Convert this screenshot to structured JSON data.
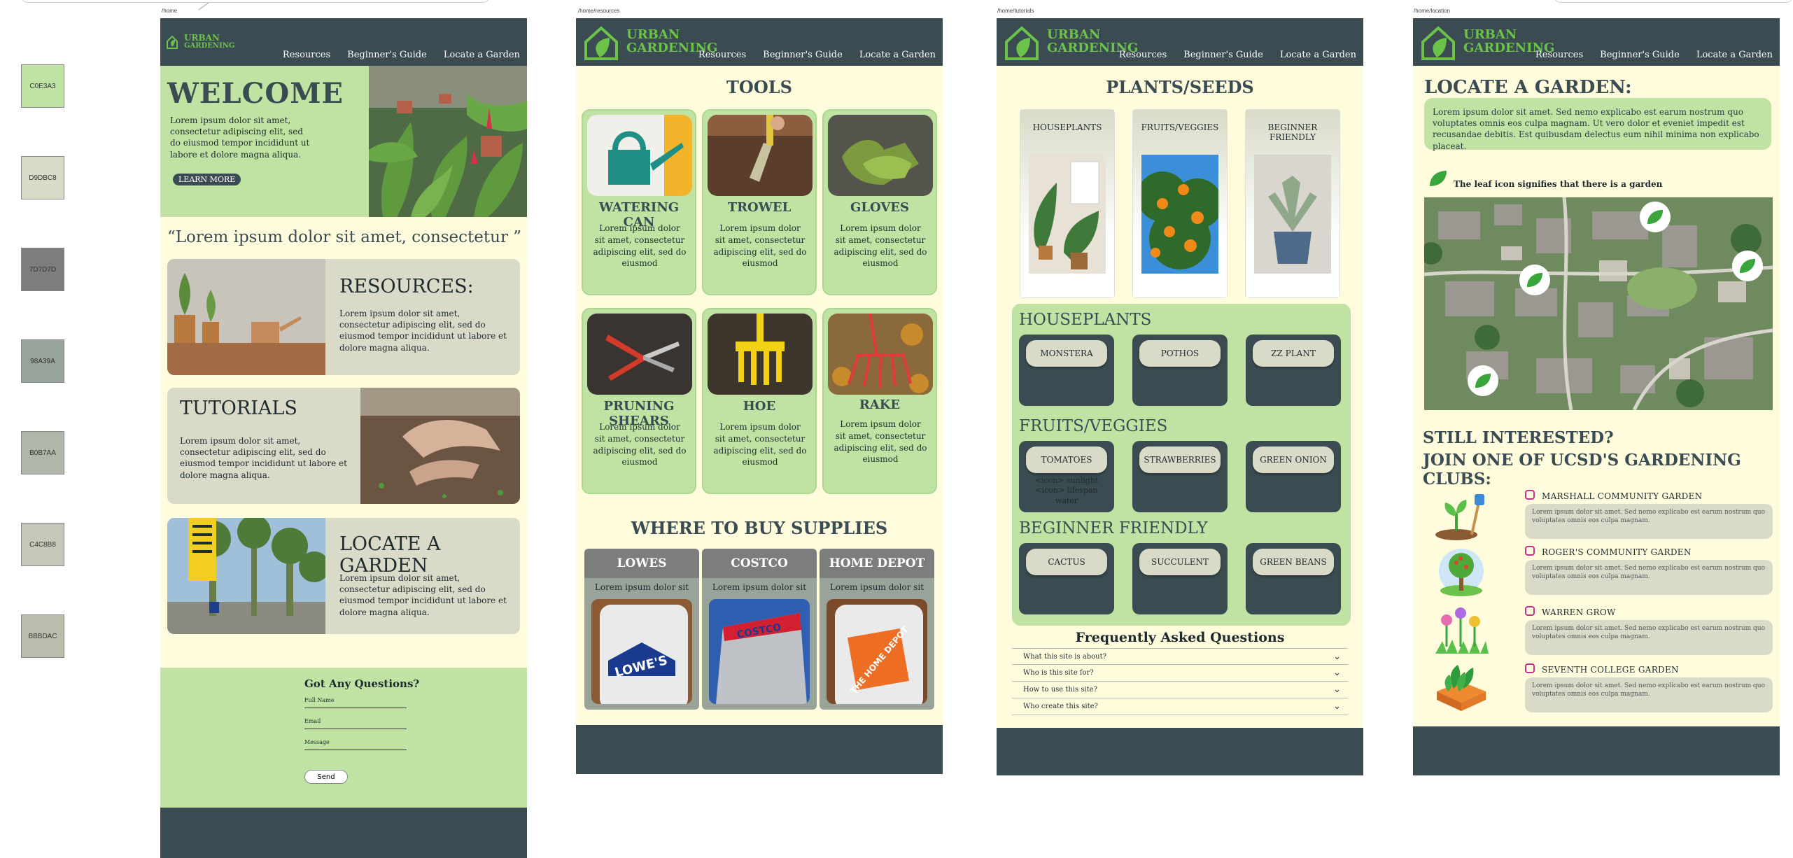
{
  "swatches": [
    "C0E3A3",
    "D9DBC8",
    "7D7D7D",
    "98A39A",
    "B0B7AA",
    "C4C8B8",
    "BBBDAC"
  ],
  "nav": {
    "logo_line1": "URBAN",
    "logo_line2": "GARDENING",
    "links": [
      "Resources",
      "Beginner's Guide",
      "Locate a Garden"
    ]
  },
  "home": {
    "path": "/home",
    "welcome_title": "WELCOME",
    "welcome_text": "Lorem ipsum dolor sit amet, consectetur adipiscing elit, sed do eiusmod tempor incididunt ut labore et dolore magna aliqua.",
    "learn_more": "LEARN MORE",
    "quote": "“Lorem ipsum dolor sit amet, consectetur ”",
    "cards": [
      {
        "title": "RESOURCES:",
        "text": "Lorem ipsum dolor sit amet, consectetur adipiscing elit, sed do eiusmod tempor incididunt ut labore et dolore magna aliqua."
      },
      {
        "title": "TUTORIALS",
        "text": "Lorem ipsum dolor sit amet, consectetur adipiscing elit, sed do eiusmod tempor incididunt ut labore et dolore magna aliqua."
      },
      {
        "title": "LOCATE A GARDEN",
        "text": "Lorem ipsum dolor sit amet, consectetur adipiscing elit, sed do eiusmod tempor incididunt ut labore et dolore magna aliqua."
      }
    ],
    "questions_title": "Got Any Questions?",
    "fields": [
      "Full Name",
      "Email",
      "Message"
    ],
    "send": "Send"
  },
  "resources": {
    "path": "/home/resources",
    "tools_title": "TOOLS",
    "tools": [
      {
        "name": "WATERING CAN",
        "text": "Lorem ipsum dolor sit amet, consectetur adipiscing elit, sed do eiusmod"
      },
      {
        "name": "TROWEL",
        "text": "Lorem ipsum dolor sit amet, consectetur adipiscing elit, sed do eiusmod"
      },
      {
        "name": "GLOVES",
        "text": "Lorem ipsum dolor sit amet, consectetur adipiscing elit, sed do eiusmod"
      },
      {
        "name": "PRUNING SHEARS",
        "text": "Lorem ipsum dolor sit amet, consectetur adipiscing elit, sed do eiusmod"
      },
      {
        "name": "HOE",
        "text": "Lorem ipsum dolor sit amet, consectetur adipiscing elit, sed do eiusmod"
      },
      {
        "name": "RAKE",
        "text": "Lorem ipsum dolor sit amet, consectetur adipiscing elit, sed do eiusmod"
      }
    ],
    "supplies_title": "WHERE TO BUY SUPPLIES",
    "stores": [
      {
        "name": "LOWES",
        "text": "Lorem ipsum dolor sit",
        "logo": "LOWE'S"
      },
      {
        "name": "COSTCO",
        "text": "Lorem ipsum dolor sit",
        "logo": "COSTCO"
      },
      {
        "name": "HOME DEPOT",
        "text": "Lorem ipsum dolor sit",
        "logo": "THE HOME DEPOT"
      }
    ]
  },
  "tutorials": {
    "path": "/home/tutorials",
    "title": "PLANTS/SEEDS",
    "categories": [
      "HOUSEPLANTS",
      "FRUITS/VEGGIES",
      "BEGINNER FRIENDLY"
    ],
    "groups": [
      {
        "title": "HOUSEPLANTS",
        "items": [
          "MONSTERA",
          "POTHOS",
          "ZZ PLANT"
        ]
      },
      {
        "title": "FRUITS/VEGGIES",
        "items": [
          "TOMATOES",
          "STRAWBERRIES",
          "GREEN ONION"
        ],
        "tomato_note": [
          "<icon> sunlight",
          "<icon> lifespan",
          "water"
        ]
      },
      {
        "title": "BEGINNER FRIENDLY",
        "items": [
          "CACTUS",
          "SUCCULENT",
          "GREEN BEANS"
        ]
      }
    ],
    "faq_title": "Frequently Asked Questions",
    "faq": [
      "What this site is about?",
      "Who is this site for?",
      "How to use this site?",
      "Who create this site?"
    ]
  },
  "location": {
    "path": "/home/location",
    "title": "LOCATE A GARDEN:",
    "intro": "Lorem ipsum dolor sit amet. Sed nemo explicabo est earum nostrum quo voluptates omnis eos culpa magnam. Ut vero dolor et eveniet impedit est recusandae debitis. Est quibusdam delectus eum nihil minima non explicabo placeat.",
    "legend": "The leaf icon signifies that there is a garden",
    "still1": "STILL INTERESTED?",
    "still2": "JOIN ONE OF UCSD'S GARDENING CLUBS:",
    "clubs": [
      {
        "name": "MARSHALL COMMUNITY GARDEN",
        "desc": "Lorem ipsum dolor sit amet. Sed nemo explicabo est earum nostrum quo voluptates omnis eos culpa magnam."
      },
      {
        "name": "ROGER'S COMMUNITY GARDEN",
        "desc": "Lorem ipsum dolor sit amet. Sed nemo explicabo est earum nostrum quo voluptates omnis eos culpa magnam."
      },
      {
        "name": "WARREN GROW",
        "desc": "Lorem ipsum dolor sit amet. Sed nemo explicabo est earum nostrum quo voluptates omnis eos culpa magnam."
      },
      {
        "name": "SEVENTH COLLEGE GARDEN",
        "desc": "Lorem ipsum dolor sit amet. Sed nemo explicabo est earum nostrum quo voluptates omnis eos culpa magnam."
      }
    ]
  }
}
